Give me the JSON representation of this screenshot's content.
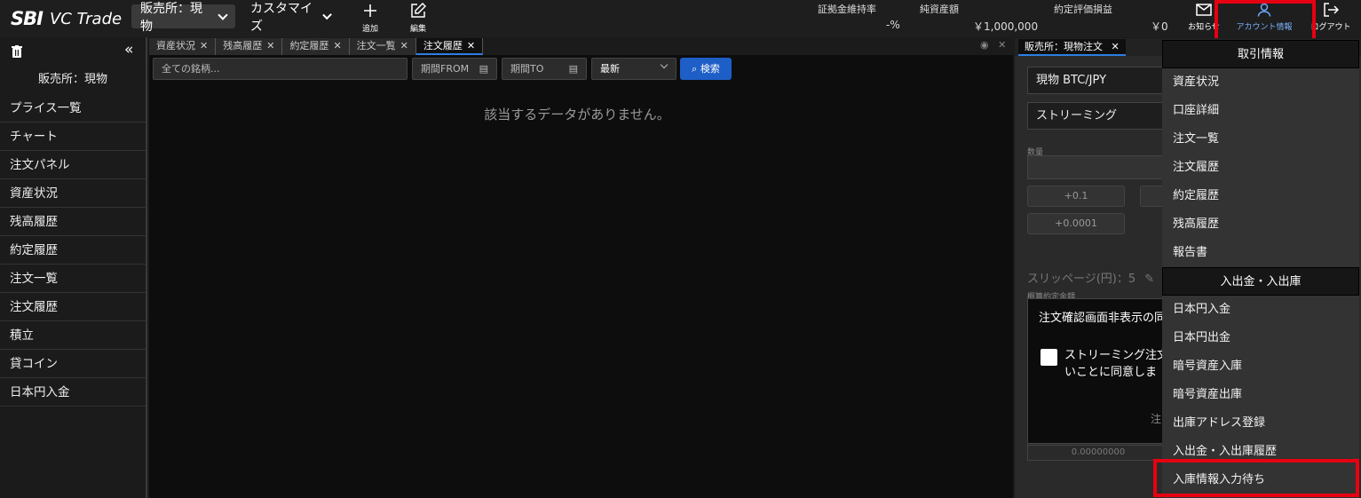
{
  "header": {
    "logo_sbi": "SBI",
    "logo_text": "VC Trade",
    "mode_label": "販売所：現物",
    "customize_label": "カスタマイズ",
    "add_label": "追加",
    "edit_label": "編集",
    "margin_rate_label": "証拠金維持率",
    "margin_rate_value": "-%",
    "net_assets_label": "純資産額",
    "net_assets_value": "￥1,000,000",
    "unrealized_label": "約定評価損益",
    "unrealized_value": "￥0",
    "notice_label": "お知らせ",
    "account_label": "アカウント情報",
    "logout_label": "ログアウト"
  },
  "sidebar": {
    "collapse_glyph": "«",
    "title": "販売所：現物",
    "items": [
      "プライス一覧",
      "チャート",
      "注文パネル",
      "資産状況",
      "残高履歴",
      "約定履歴",
      "注文一覧",
      "注文履歴",
      "積立",
      "貸コイン",
      "日本円入金"
    ]
  },
  "tabs": [
    {
      "label": "資産状況",
      "active": false
    },
    {
      "label": "残高履歴",
      "active": false
    },
    {
      "label": "約定履歴",
      "active": false
    },
    {
      "label": "注文一覧",
      "active": false
    },
    {
      "label": "注文履歴",
      "active": true
    }
  ],
  "filters": {
    "symbol_placeholder": "全ての銘柄...",
    "from_label": "期間FROM",
    "to_label": "期間TO",
    "sort_value": "最新",
    "search_label": "検索"
  },
  "main": {
    "empty_message": "該当するデータがありません。"
  },
  "order_panel": {
    "tab_label": "販売所：現物注文",
    "pair": "現物 BTC/JPY",
    "order_type": "ストリーミング",
    "qty_label": "数量",
    "step1": "+0.1",
    "step2": "+0.0001",
    "slippage": "スリッページ(円)：5",
    "total_label": "概算約定金額",
    "confirm_text": "注文確認画面非表示の同",
    "agree_line1": "ストリーミング注文",
    "agree_line2": "いことに同意しま",
    "note": "注",
    "zero_value": "0.00000000"
  },
  "account_menu": {
    "section1_title": "取引情報",
    "section1_items": [
      "資産状況",
      "口座詳細",
      "注文一覧",
      "注文履歴",
      "約定履歴",
      "残高履歴",
      "報告書"
    ],
    "section2_title": "入出金・入出庫",
    "section2_items": [
      "日本円入金",
      "日本円出金",
      "暗号資産入庫",
      "暗号資産出庫",
      "出庫アドレス登録",
      "入出金・入出庫履歴",
      "入庫情報入力待ち"
    ]
  },
  "colors": {
    "highlight": "#e60012",
    "accent_blue": "#1e5ec7",
    "background": "#1b1b1b"
  }
}
